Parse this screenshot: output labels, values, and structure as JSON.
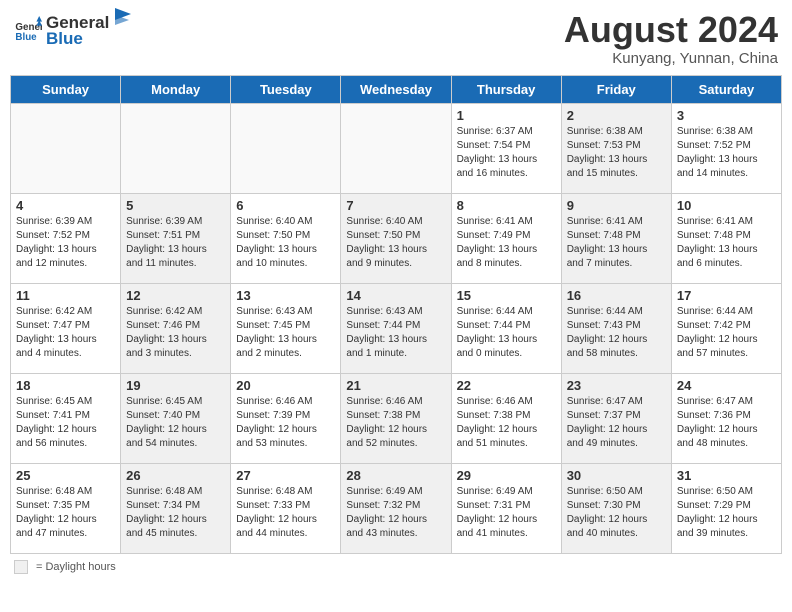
{
  "logo": {
    "text_general": "General",
    "text_blue": "Blue"
  },
  "title": "August 2024",
  "subtitle": "Kunyang, Yunnan, China",
  "days_of_week": [
    "Sunday",
    "Monday",
    "Tuesday",
    "Wednesday",
    "Thursday",
    "Friday",
    "Saturday"
  ],
  "weeks": [
    [
      {
        "day": "",
        "content": "",
        "empty": true
      },
      {
        "day": "",
        "content": "",
        "empty": true
      },
      {
        "day": "",
        "content": "",
        "empty": true
      },
      {
        "day": "",
        "content": "",
        "empty": true
      },
      {
        "day": "1",
        "content": "Sunrise: 6:37 AM\nSunset: 7:54 PM\nDaylight: 13 hours\nand 16 minutes.",
        "empty": false,
        "shaded": false
      },
      {
        "day": "2",
        "content": "Sunrise: 6:38 AM\nSunset: 7:53 PM\nDaylight: 13 hours\nand 15 minutes.",
        "empty": false,
        "shaded": true
      },
      {
        "day": "3",
        "content": "Sunrise: 6:38 AM\nSunset: 7:52 PM\nDaylight: 13 hours\nand 14 minutes.",
        "empty": false,
        "shaded": false
      }
    ],
    [
      {
        "day": "4",
        "content": "Sunrise: 6:39 AM\nSunset: 7:52 PM\nDaylight: 13 hours\nand 12 minutes.",
        "empty": false,
        "shaded": false
      },
      {
        "day": "5",
        "content": "Sunrise: 6:39 AM\nSunset: 7:51 PM\nDaylight: 13 hours\nand 11 minutes.",
        "empty": false,
        "shaded": true
      },
      {
        "day": "6",
        "content": "Sunrise: 6:40 AM\nSunset: 7:50 PM\nDaylight: 13 hours\nand 10 minutes.",
        "empty": false,
        "shaded": false
      },
      {
        "day": "7",
        "content": "Sunrise: 6:40 AM\nSunset: 7:50 PM\nDaylight: 13 hours\nand 9 minutes.",
        "empty": false,
        "shaded": true
      },
      {
        "day": "8",
        "content": "Sunrise: 6:41 AM\nSunset: 7:49 PM\nDaylight: 13 hours\nand 8 minutes.",
        "empty": false,
        "shaded": false
      },
      {
        "day": "9",
        "content": "Sunrise: 6:41 AM\nSunset: 7:48 PM\nDaylight: 13 hours\nand 7 minutes.",
        "empty": false,
        "shaded": true
      },
      {
        "day": "10",
        "content": "Sunrise: 6:41 AM\nSunset: 7:48 PM\nDaylight: 13 hours\nand 6 minutes.",
        "empty": false,
        "shaded": false
      }
    ],
    [
      {
        "day": "11",
        "content": "Sunrise: 6:42 AM\nSunset: 7:47 PM\nDaylight: 13 hours\nand 4 minutes.",
        "empty": false,
        "shaded": false
      },
      {
        "day": "12",
        "content": "Sunrise: 6:42 AM\nSunset: 7:46 PM\nDaylight: 13 hours\nand 3 minutes.",
        "empty": false,
        "shaded": true
      },
      {
        "day": "13",
        "content": "Sunrise: 6:43 AM\nSunset: 7:45 PM\nDaylight: 13 hours\nand 2 minutes.",
        "empty": false,
        "shaded": false
      },
      {
        "day": "14",
        "content": "Sunrise: 6:43 AM\nSunset: 7:44 PM\nDaylight: 13 hours\nand 1 minute.",
        "empty": false,
        "shaded": true
      },
      {
        "day": "15",
        "content": "Sunrise: 6:44 AM\nSunset: 7:44 PM\nDaylight: 13 hours\nand 0 minutes.",
        "empty": false,
        "shaded": false
      },
      {
        "day": "16",
        "content": "Sunrise: 6:44 AM\nSunset: 7:43 PM\nDaylight: 12 hours\nand 58 minutes.",
        "empty": false,
        "shaded": true
      },
      {
        "day": "17",
        "content": "Sunrise: 6:44 AM\nSunset: 7:42 PM\nDaylight: 12 hours\nand 57 minutes.",
        "empty": false,
        "shaded": false
      }
    ],
    [
      {
        "day": "18",
        "content": "Sunrise: 6:45 AM\nSunset: 7:41 PM\nDaylight: 12 hours\nand 56 minutes.",
        "empty": false,
        "shaded": false
      },
      {
        "day": "19",
        "content": "Sunrise: 6:45 AM\nSunset: 7:40 PM\nDaylight: 12 hours\nand 54 minutes.",
        "empty": false,
        "shaded": true
      },
      {
        "day": "20",
        "content": "Sunrise: 6:46 AM\nSunset: 7:39 PM\nDaylight: 12 hours\nand 53 minutes.",
        "empty": false,
        "shaded": false
      },
      {
        "day": "21",
        "content": "Sunrise: 6:46 AM\nSunset: 7:38 PM\nDaylight: 12 hours\nand 52 minutes.",
        "empty": false,
        "shaded": true
      },
      {
        "day": "22",
        "content": "Sunrise: 6:46 AM\nSunset: 7:38 PM\nDaylight: 12 hours\nand 51 minutes.",
        "empty": false,
        "shaded": false
      },
      {
        "day": "23",
        "content": "Sunrise: 6:47 AM\nSunset: 7:37 PM\nDaylight: 12 hours\nand 49 minutes.",
        "empty": false,
        "shaded": true
      },
      {
        "day": "24",
        "content": "Sunrise: 6:47 AM\nSunset: 7:36 PM\nDaylight: 12 hours\nand 48 minutes.",
        "empty": false,
        "shaded": false
      }
    ],
    [
      {
        "day": "25",
        "content": "Sunrise: 6:48 AM\nSunset: 7:35 PM\nDaylight: 12 hours\nand 47 minutes.",
        "empty": false,
        "shaded": false
      },
      {
        "day": "26",
        "content": "Sunrise: 6:48 AM\nSunset: 7:34 PM\nDaylight: 12 hours\nand 45 minutes.",
        "empty": false,
        "shaded": true
      },
      {
        "day": "27",
        "content": "Sunrise: 6:48 AM\nSunset: 7:33 PM\nDaylight: 12 hours\nand 44 minutes.",
        "empty": false,
        "shaded": false
      },
      {
        "day": "28",
        "content": "Sunrise: 6:49 AM\nSunset: 7:32 PM\nDaylight: 12 hours\nand 43 minutes.",
        "empty": false,
        "shaded": true
      },
      {
        "day": "29",
        "content": "Sunrise: 6:49 AM\nSunset: 7:31 PM\nDaylight: 12 hours\nand 41 minutes.",
        "empty": false,
        "shaded": false
      },
      {
        "day": "30",
        "content": "Sunrise: 6:50 AM\nSunset: 7:30 PM\nDaylight: 12 hours\nand 40 minutes.",
        "empty": false,
        "shaded": true
      },
      {
        "day": "31",
        "content": "Sunrise: 6:50 AM\nSunset: 7:29 PM\nDaylight: 12 hours\nand 39 minutes.",
        "empty": false,
        "shaded": false
      }
    ]
  ],
  "legend": {
    "box_label": "= Daylight hours"
  }
}
